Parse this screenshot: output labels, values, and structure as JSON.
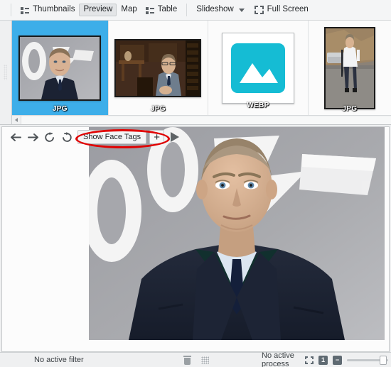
{
  "viewbar": {
    "items": [
      {
        "label": "Thumbnails",
        "icon": "list-icon",
        "active": false
      },
      {
        "label": "Preview",
        "icon": "",
        "active": true
      },
      {
        "label": "Map",
        "icon": "",
        "active": false
      },
      {
        "label": "Table",
        "icon": "list-icon",
        "active": false
      },
      {
        "label": "Slideshow",
        "icon": "chevron-down-icon",
        "active": false
      },
      {
        "label": "Full Screen",
        "icon": "fullscreen-icon",
        "active": false
      }
    ]
  },
  "thumbnails": {
    "items": [
      {
        "badge": "JPG",
        "kind": "photo-bond-premiere",
        "selected": true
      },
      {
        "badge": "JPG",
        "kind": "photo-bond-office",
        "selected": false
      },
      {
        "badge": "WEBP",
        "kind": "placeholder-image",
        "selected": false
      },
      {
        "badge": "JPG",
        "kind": "photo-bond-desert",
        "selected": false
      }
    ],
    "selection_color": "#3daee9"
  },
  "preview": {
    "toolbar": {
      "back": "back-arrow",
      "forward": "forward-arrow",
      "rotate_left": "rotate-ccw",
      "rotate_right": "rotate-cw",
      "face_tags_label": "Show Face Tags",
      "add_label": "+",
      "play": "play-triangle"
    },
    "annotation": {
      "shape": "ellipse",
      "color": "#e00000",
      "target": "Show Face Tags"
    },
    "image": {
      "caption": "007"
    }
  },
  "statusbar": {
    "filter_text": "No active filter",
    "process_text": "No active process",
    "trash_icon": "trash-icon",
    "grid_icon": "dot-grid-icon",
    "fit_icon": "fit-to-window-icon",
    "zoom_100_label": "1",
    "zoom_out_label": "−",
    "zoom_value": 92
  }
}
